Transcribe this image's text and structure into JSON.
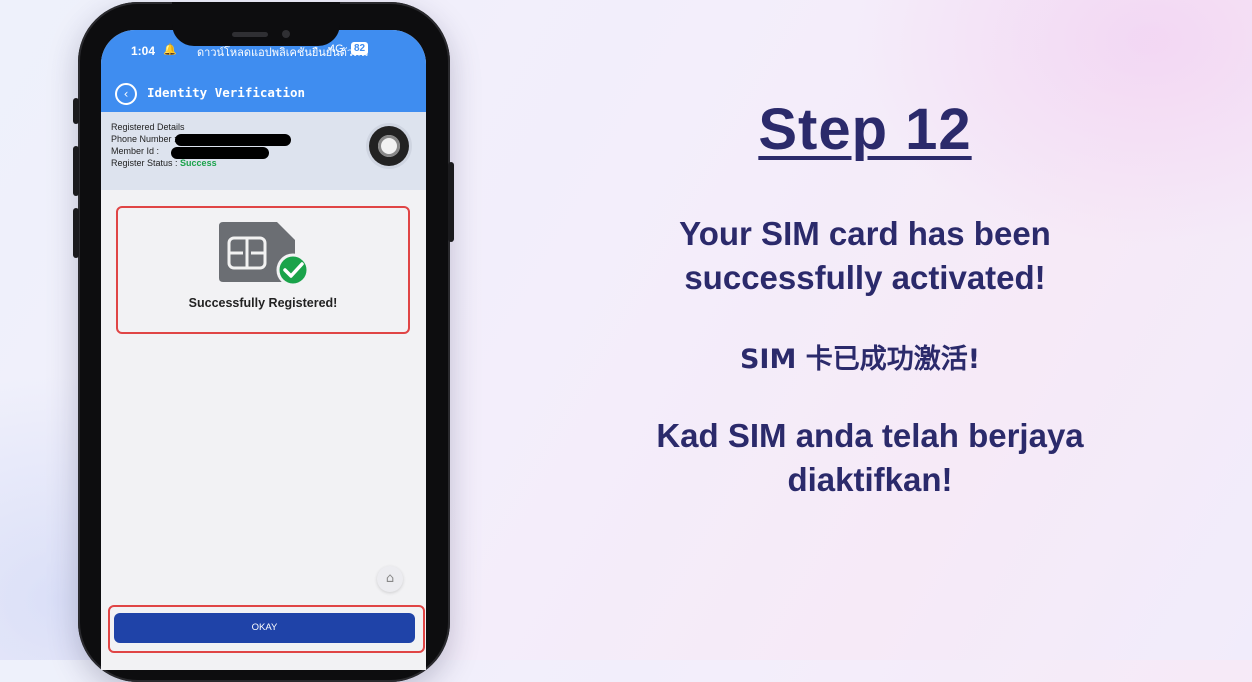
{
  "phone": {
    "status_bar": {
      "time": "1:04",
      "carrier_text": "ดาวน์โหลดแอปพลิเคชันยืนยันตัวตน",
      "network": "4G",
      "battery": "82"
    },
    "app_bar": {
      "title": "Identity Verification",
      "back_icon": "chevron-left-circle-icon"
    },
    "details": {
      "heading": "Registered Details",
      "phone_label": "Phone Number :",
      "member_label": "Member Id :",
      "status_label": "Register Status :",
      "status_value": "Success"
    },
    "success_card": {
      "icon": "sim-card-check-icon",
      "message": "Successfully Registered!"
    },
    "home_icon": "home-icon",
    "okay_button": "OKAY"
  },
  "slide": {
    "title": "Step 12",
    "message_en": "Your SIM card has been successfully activated!",
    "message_zh": "SIM 卡已成功激活!",
    "message_ms": "Kad SIM anda telah berjaya diaktifkan!"
  },
  "colors": {
    "app_blue": "#3f8df0",
    "button_blue": "#1f43a8",
    "highlight_red": "#e04545",
    "success_green": "#1aa34a",
    "heading_navy": "#2b2a6b"
  }
}
